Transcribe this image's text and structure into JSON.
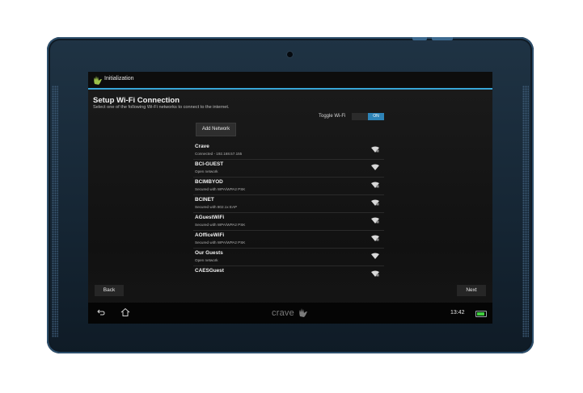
{
  "titlebar": {
    "title": "Initialization"
  },
  "setup": {
    "heading": "Setup Wi-Fi Connection",
    "subtitle": "Select one of the following Wi-Fi networks to connect to the internet.",
    "toggle_label": "Toggle Wi-Fi",
    "toggle_state": "ON",
    "add_network_label": "Add Network"
  },
  "networks": [
    {
      "name": "Crave",
      "status": "Connected - 192.168.57.155",
      "icon": "wifi-locked-icon"
    },
    {
      "name": "BCI-GUEST",
      "status": "Open network",
      "icon": "wifi-open-icon"
    },
    {
      "name": "BCIMBYOD",
      "status": "Secured with WPA/WPA2 PSK",
      "icon": "wifi-locked-icon"
    },
    {
      "name": "BCINET",
      "status": "Secured with 802.1x EAP",
      "icon": "wifi-locked-icon"
    },
    {
      "name": "AGuestWiFi",
      "status": "Secured with WPA/WPA2 PSK",
      "icon": "wifi-locked-icon"
    },
    {
      "name": "AOfficeWiFi",
      "status": "Secured with WPA/WPA2 PSK",
      "icon": "wifi-locked-icon"
    },
    {
      "name": "Our Guests",
      "status": "Open network",
      "icon": "wifi-open-icon"
    },
    {
      "name": "CAESGuest",
      "status": "",
      "icon": "wifi-locked-icon"
    }
  ],
  "buttons": {
    "back": "Back",
    "next": "Next"
  },
  "navbar": {
    "brand": "crave",
    "clock": "13:42"
  },
  "colors": {
    "accent": "#38a6d8",
    "toggle_on": "#2e84b8",
    "battery": "#3fcf3f",
    "logo_green": "#9bc14a"
  }
}
